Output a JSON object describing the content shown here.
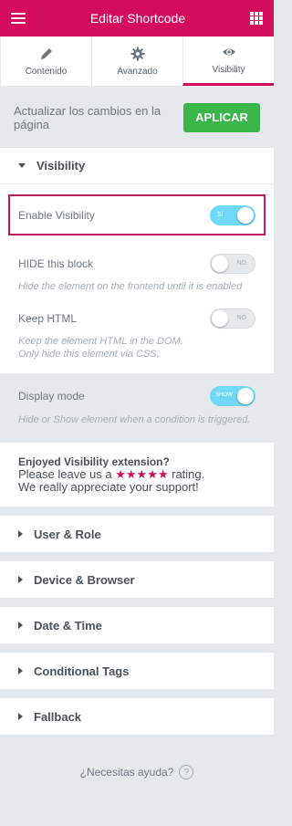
{
  "header": {
    "title": "Editar Shortcode"
  },
  "tabs": [
    {
      "label": "Contenido",
      "icon": "pencil-icon"
    },
    {
      "label": "Avanzado",
      "icon": "gear-icon"
    },
    {
      "label": "Visibility",
      "icon": "eye-icon",
      "active": true
    }
  ],
  "apply": {
    "note": "Actualizar los cambios en la página",
    "button": "APLICAR"
  },
  "visibility": {
    "title": "Visibility",
    "enable": {
      "label": "Enable Visibility",
      "state": "SÍ",
      "on": true
    },
    "hide": {
      "label": "HIDE this block",
      "state": "NO",
      "on": false,
      "desc": "Hide the element on the frontend until it is enabled"
    },
    "keep": {
      "label": "Keep HTML",
      "state": "NO",
      "on": false,
      "desc": "Keep the element HTML in the DOM. Only hide this element via CSS."
    },
    "display": {
      "label": "Display mode",
      "state": "SHOW",
      "on": true,
      "desc": "Hide or Show element when a condition is triggered."
    }
  },
  "promo": {
    "question": "Enjoyed Visibility extension?",
    "line1_pre": "Please leave us a ",
    "stars": "★★★★★",
    "line1_post": " rating.",
    "line2": "We really appreciate your support!"
  },
  "sections": [
    "User & Role",
    "Device & Browser",
    "Date & Time",
    "Conditional Tags",
    "Fallback"
  ],
  "help": {
    "label": "¿Necesitas ayuda?",
    "icon": "question-icon"
  },
  "colors": {
    "brand": "#d30c5c",
    "apply": "#39b54a",
    "switch_on": "#71d7f7"
  }
}
